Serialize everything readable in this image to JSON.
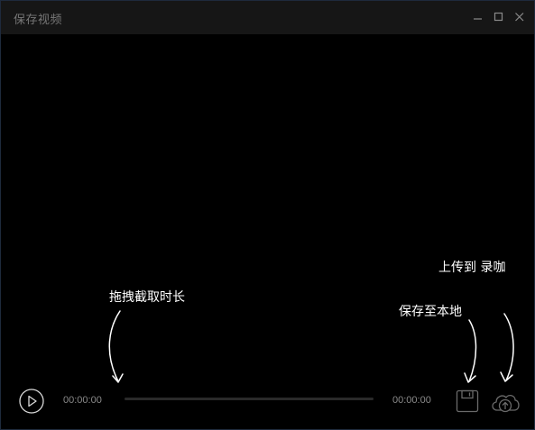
{
  "window": {
    "title": "保存视频",
    "controls": {
      "minimize_icon": "minimize-icon",
      "maximize_icon": "maximize-icon",
      "close_icon": "close-icon"
    }
  },
  "player": {
    "current_time": "00:00:00",
    "end_time": "00:00:00",
    "progress": 0,
    "play_icon": "play-icon",
    "save_icon": "floppy-disk-icon",
    "upload_icon": "cloud-upload-icon"
  },
  "hints": {
    "drag_label": "拖拽截取时长",
    "save_label": "保存至本地",
    "upload_label": "上传到 录咖"
  },
  "colors": {
    "background": "#000000",
    "titlebar": "#161616",
    "title_text": "#777777",
    "control_icon": "#8a8a8a",
    "hint_text": "#ffffff"
  }
}
